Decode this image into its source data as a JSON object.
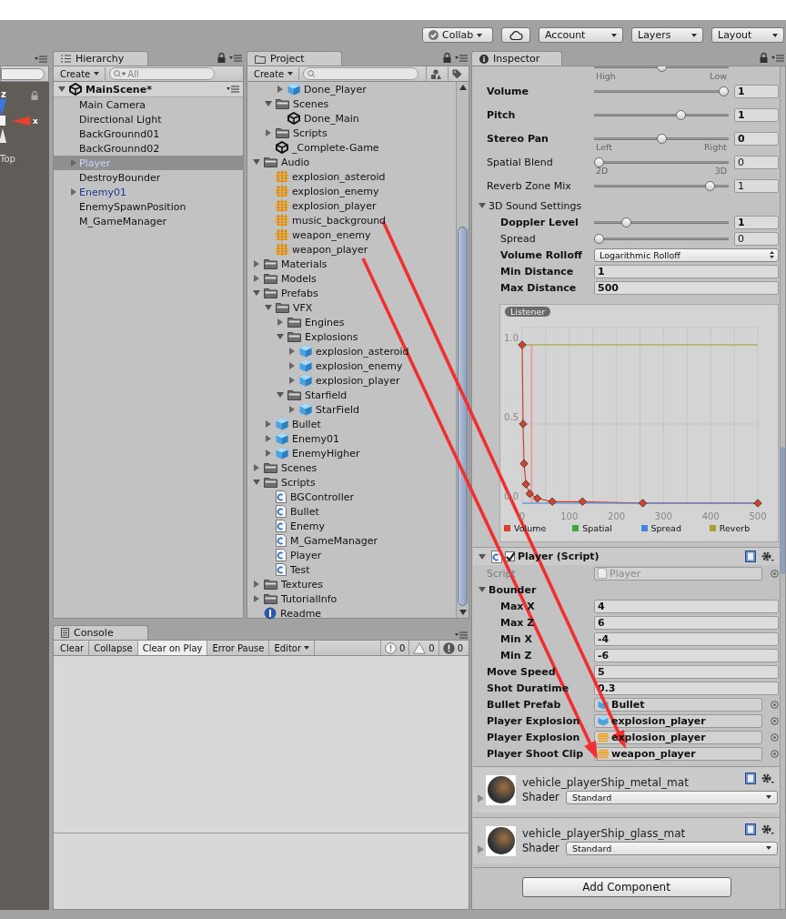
{
  "toolbar": {
    "buttons": [
      {
        "kind": "collab",
        "label": "Collab"
      },
      {
        "kind": "cloud"
      },
      {
        "kind": "dropdown",
        "label": "Account"
      },
      {
        "kind": "dropdown",
        "label": "Layers"
      },
      {
        "kind": "dropdown",
        "label": "Layout"
      }
    ]
  },
  "scene_view": {
    "gizmo_labels": [
      "z",
      "x"
    ],
    "view_label": "Top"
  },
  "hierarchy": {
    "tab": "Hierarchy",
    "create": "Create",
    "search": {
      "placeholder": "All"
    },
    "scene": {
      "label": "MainScene*",
      "expanded": true
    },
    "items": [
      {
        "label": "Main Camera",
        "prefab": false,
        "selected": false
      },
      {
        "label": "Directional Light",
        "prefab": false,
        "selected": false
      },
      {
        "label": "BackGrounnd01",
        "prefab": false,
        "selected": false
      },
      {
        "label": "BackGrounnd02",
        "prefab": false,
        "selected": false
      },
      {
        "label": "Player",
        "prefab": true,
        "selected": true,
        "expanded": false
      },
      {
        "label": "DestroyBounder",
        "prefab": false,
        "selected": false
      },
      {
        "label": "Enemy01",
        "prefab": true,
        "selected": false,
        "expanded": false
      },
      {
        "label": "EnemySpawnPosition",
        "prefab": false,
        "selected": false
      },
      {
        "label": "M_GameManager",
        "prefab": false,
        "selected": false
      }
    ]
  },
  "project": {
    "tab": "Project",
    "create": "Create",
    "tree": [
      {
        "children": [
          {
            "children": [
              {
                "label": "Done_Player",
                "kind": "prefab",
                "expanded": false
              }
            ]
          },
          {
            "label": "Scenes",
            "kind": "folder",
            "expanded": true,
            "children": [
              {
                "label": "Done_Main",
                "kind": "scene"
              }
            ]
          },
          {
            "label": "Scripts",
            "kind": "folder",
            "expanded": false
          },
          {
            "label": "_Complete-Game",
            "kind": "scene"
          }
        ]
      },
      {
        "label": "Audio",
        "kind": "folder",
        "expanded": true,
        "children": [
          {
            "label": "explosion_asteroid",
            "kind": "audio"
          },
          {
            "label": "explosion_enemy",
            "kind": "audio"
          },
          {
            "label": "explosion_player",
            "kind": "audio"
          },
          {
            "label": "music_background",
            "kind": "audio"
          },
          {
            "label": "weapon_enemy",
            "kind": "audio"
          },
          {
            "label": "weapon_player",
            "kind": "audio"
          }
        ]
      },
      {
        "label": "Materials",
        "kind": "folder",
        "expanded": false
      },
      {
        "label": "Models",
        "kind": "folder",
        "expanded": false
      },
      {
        "label": "Prefabs",
        "kind": "folder",
        "expanded": true,
        "children": [
          {
            "label": "VFX",
            "kind": "folder",
            "expanded": true,
            "children": [
              {
                "label": "Engines",
                "kind": "folder",
                "expanded": false
              },
              {
                "label": "Explosions",
                "kind": "folder",
                "expanded": true,
                "children": [
                  {
                    "label": "explosion_asteroid",
                    "kind": "prefab",
                    "expanded": false
                  },
                  {
                    "label": "explosion_enemy",
                    "kind": "prefab",
                    "expanded": false
                  },
                  {
                    "label": "explosion_player",
                    "kind": "prefab",
                    "expanded": false
                  }
                ]
              },
              {
                "label": "Starfield",
                "kind": "folder",
                "expanded": true,
                "children": [
                  {
                    "label": "StarField",
                    "kind": "prefab",
                    "expanded": false
                  }
                ]
              }
            ]
          },
          {
            "label": "Bullet",
            "kind": "prefab",
            "expanded": false
          },
          {
            "label": "Enemy01",
            "kind": "prefab",
            "expanded": false
          },
          {
            "label": "EnemyHigher",
            "kind": "prefab",
            "expanded": false
          }
        ]
      },
      {
        "label": "Scenes",
        "kind": "folder",
        "expanded": false
      },
      {
        "label": "Scripts",
        "kind": "folder",
        "expanded": true,
        "children": [
          {
            "label": "BGController",
            "kind": "script"
          },
          {
            "label": "Bullet",
            "kind": "script"
          },
          {
            "label": "Enemy",
            "kind": "script"
          },
          {
            "label": "M_GameManager",
            "kind": "script"
          },
          {
            "label": "Player",
            "kind": "script"
          },
          {
            "label": "Test",
            "kind": "script"
          }
        ]
      },
      {
        "label": "Textures",
        "kind": "folder",
        "expanded": false
      },
      {
        "label": "TutorialInfo",
        "kind": "folder",
        "expanded": false
      },
      {
        "label": "Readme",
        "kind": "info"
      }
    ]
  },
  "console": {
    "tab": "Console",
    "buttons": [
      {
        "label": "Clear",
        "kind": "button",
        "selected": false
      },
      {
        "label": "Collapse",
        "kind": "toggle",
        "selected": false
      },
      {
        "label": "Clear on Play",
        "kind": "toggle",
        "selected": true
      },
      {
        "label": "Error Pause",
        "kind": "toggle",
        "selected": false
      },
      {
        "label": "Editor",
        "kind": "dropdown",
        "selected": false
      }
    ],
    "counts": [
      {
        "kind": "info",
        "count": "0"
      },
      {
        "kind": "warning",
        "count": "0"
      },
      {
        "kind": "error",
        "count": "0"
      }
    ]
  },
  "inspector": {
    "tab": "Inspector",
    "audio_rows": [
      {
        "kind": "scale",
        "level": 0.5,
        "scale": [
          "High",
          "Low"
        ]
      },
      {
        "kind": "slider",
        "label": "Volume",
        "overridden": true,
        "level": 1,
        "value": "1"
      },
      {
        "kind": "slider",
        "label": "Pitch",
        "overridden": true,
        "level": 0.66,
        "value": "1"
      },
      {
        "kind": "slider",
        "label": "Stereo Pan",
        "overridden": true,
        "level": 0.5,
        "value": "0",
        "scale": [
          "Left",
          "Right"
        ]
      },
      {
        "kind": "slider",
        "label": "Spatial Blend",
        "overridden": false,
        "level": 0,
        "value": "0",
        "scale": [
          "2D",
          "3D"
        ]
      },
      {
        "kind": "slider",
        "label": "Reverb Zone Mix",
        "overridden": false,
        "level": 0.89,
        "value": "1"
      },
      {
        "kind": "section",
        "label": "3D Sound Settings",
        "overridden": false,
        "expanded": true,
        "children": [
          {
            "kind": "slider",
            "label": "Doppler Level",
            "overridden": true,
            "level": 0.22,
            "value": "1"
          },
          {
            "kind": "slider",
            "label": "Spread",
            "overridden": false,
            "level": 0,
            "value": "0"
          },
          {
            "kind": "dropdown",
            "label": "Volume Rolloff",
            "overridden": true,
            "value": "Logarithmic Rolloff"
          },
          {
            "kind": "field",
            "label": "Min Distance",
            "overridden": true,
            "value": "1"
          },
          {
            "kind": "field",
            "label": "Max Distance",
            "overridden": true,
            "value": "500"
          },
          {
            "kind": "chart",
            "badge": "Listener",
            "chart_data": {
              "type": "line",
              "xlim": [
                0,
                500
              ],
              "ylim": [
                0,
                1.1
              ],
              "grid": true,
              "legend": "bottom",
              "xticks": [
                0,
                100,
                200,
                300,
                400,
                500
              ],
              "yticks": [
                {
                  "value": 0,
                  "label": "0.0"
                },
                {
                  "value": 0.5,
                  "label": "0.5"
                },
                {
                  "value": 1,
                  "label": "1.0"
                }
              ],
              "ref_lines": [
                {
                  "axis": "x",
                  "value": 20
                }
              ],
              "x": [
                0,
                2,
                4,
                8,
                16,
                32,
                64,
                128,
                256,
                500
              ],
              "series": [
                {
                  "name": "Volume",
                  "color": "#d8402c",
                  "marker": "diamond",
                  "values": [
                    1,
                    0.5,
                    0.25,
                    0.12,
                    0.06,
                    0.03,
                    0.01,
                    0.01,
                    0,
                    0
                  ]
                },
                {
                  "name": "Spatial",
                  "color": "#3fa83f",
                  "values": [
                    null,
                    null,
                    null,
                    null,
                    null,
                    null,
                    null,
                    null,
                    null,
                    null
                  ]
                },
                {
                  "name": "Spread",
                  "color": "#3f86e0",
                  "values": [
                    0,
                    0,
                    0,
                    0,
                    0,
                    0,
                    0,
                    0,
                    0,
                    0
                  ]
                },
                {
                  "name": "Reverb",
                  "color": "#a8a030",
                  "values": [
                    1,
                    1,
                    1,
                    1,
                    1,
                    1,
                    1,
                    1,
                    1,
                    1
                  ]
                }
              ]
            }
          }
        ]
      }
    ],
    "script_component": {
      "title": "Player (Script)",
      "expanded": true,
      "enabled": true,
      "rows": [
        {
          "kind": "script_ref",
          "label": "Script",
          "value": "Player",
          "overridden": false,
          "disabled": true
        },
        {
          "kind": "section",
          "label": "Bounder",
          "overridden": true,
          "disabled": false,
          "expanded": true,
          "children": [
            {
              "kind": "field",
              "label": "Max X",
              "value": "4",
              "overridden": true,
              "disabled": false
            },
            {
              "kind": "field",
              "label": "Max Z",
              "value": "6",
              "overridden": true,
              "disabled": false
            },
            {
              "kind": "field",
              "label": "Min X",
              "value": "-4",
              "overridden": true,
              "disabled": false
            },
            {
              "kind": "field",
              "label": "Min Z",
              "value": "-6",
              "overridden": true,
              "disabled": false
            }
          ]
        },
        {
          "kind": "field",
          "label": "Move Speed",
          "value": "5",
          "overridden": true,
          "disabled": false
        },
        {
          "kind": "field",
          "label": "Shot Duratime",
          "value": "0.3",
          "overridden": true,
          "disabled": false
        },
        {
          "kind": "prefab_ref",
          "label": "Bullet Prefab",
          "value": "Bullet",
          "overridden": true,
          "disabled": false
        },
        {
          "kind": "prefab_ref",
          "label": "Player Explosion",
          "value": "explosion_player",
          "overridden": true,
          "disabled": false
        },
        {
          "kind": "audio_ref",
          "label": "Player Explosion",
          "value": "explosion_player",
          "overridden": true,
          "disabled": false
        },
        {
          "kind": "audio_ref",
          "label": "Player Shoot Clip",
          "value": "weapon_player",
          "overridden": true,
          "disabled": false
        }
      ]
    },
    "materials": [
      {
        "name": "vehicle_playerShip_metal_mat",
        "shader_label": "Shader",
        "shader": "Standard"
      },
      {
        "name": "vehicle_playerShip_glass_mat",
        "shader_label": "Shader",
        "shader": "Standard"
      }
    ],
    "add_component": "Add Component"
  }
}
